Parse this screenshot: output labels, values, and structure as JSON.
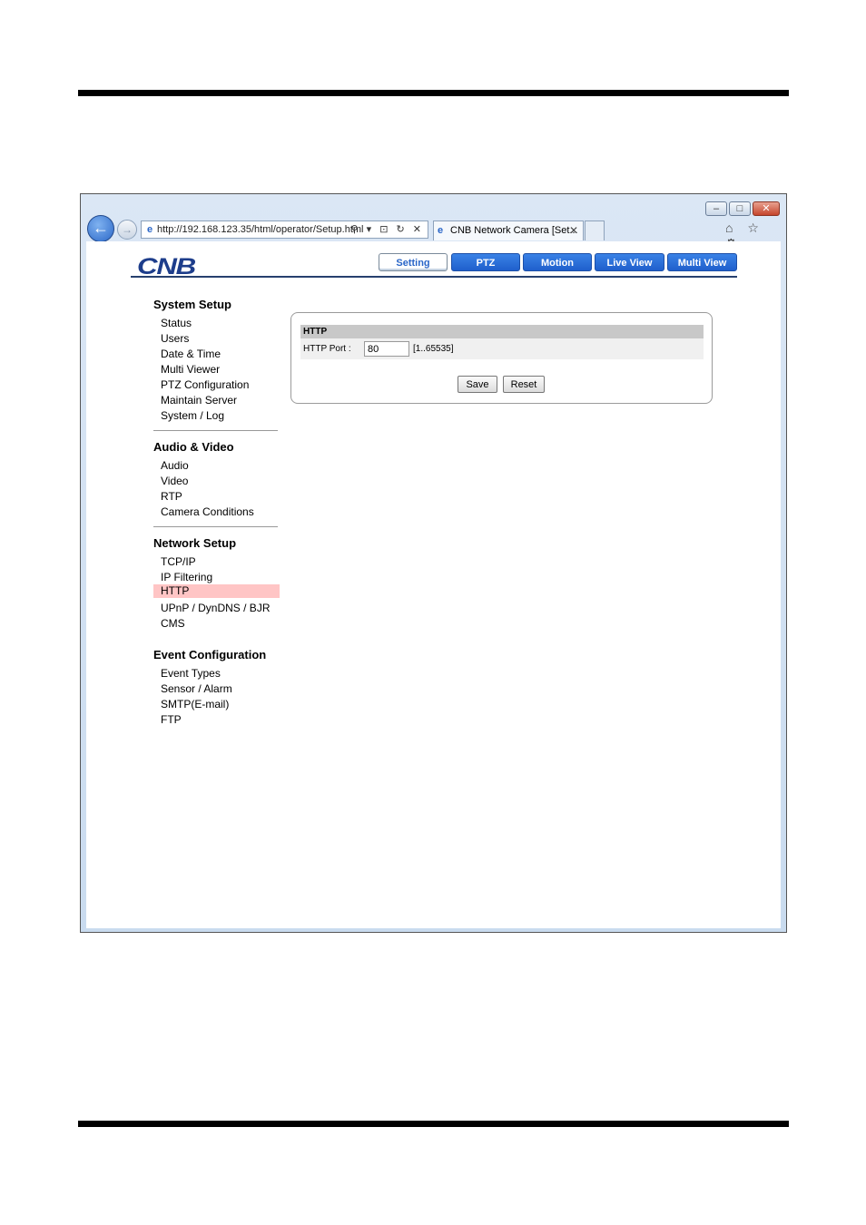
{
  "browser": {
    "address": "http://192.168.123.35/html/operator/Setup.html",
    "tab_title": "CNB Network Camera [Set...",
    "window_controls": {
      "minimize": "–",
      "maximize": "□",
      "close": "✕"
    },
    "nav_back_icon": "←",
    "nav_forward_icon": "→",
    "address_tools": "⚲ ▾ ⊡ ↻ ✕",
    "tab_close": "✕",
    "right_tools": "⌂ ☆ ⚙"
  },
  "header": {
    "logo": "CNB",
    "nav": [
      "Setting",
      "PTZ",
      "Motion",
      "Live View",
      "Multi View"
    ],
    "active_nav": "Setting"
  },
  "sidebar": {
    "sections": [
      {
        "title": "System Setup",
        "items": [
          "Status",
          "Users",
          "Date & Time",
          "Multi Viewer",
          "PTZ Configuration",
          "Maintain Server",
          "System / Log"
        ]
      },
      {
        "title": "Audio & Video",
        "items": [
          "Audio",
          "Video",
          "RTP",
          "Camera Conditions"
        ]
      },
      {
        "title": "Network Setup",
        "items": [
          "TCP/IP",
          "IP Filtering",
          "HTTP",
          "UPnP / DynDNS / BJR",
          "CMS"
        ]
      },
      {
        "title": "Event Configuration",
        "items": [
          "Event Types",
          "Sensor / Alarm",
          "SMTP(E-mail)",
          "FTP"
        ]
      }
    ],
    "selected": "HTTP"
  },
  "form": {
    "title": "HTTP",
    "port_label": "HTTP Port :",
    "port_value": "80",
    "port_range": "[1..65535]",
    "save_label": "Save",
    "reset_label": "Reset"
  },
  "colors": {
    "accent": "#2a66c8",
    "selected_row": "#ffc5c5",
    "logo": "#1d3d8b"
  }
}
